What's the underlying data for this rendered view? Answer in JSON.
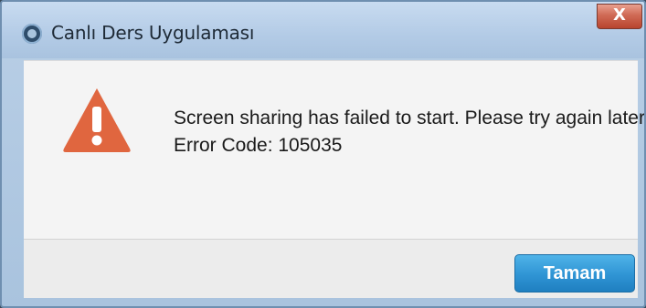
{
  "window": {
    "title": "Canlı Ders Uygulaması",
    "close_label": "X",
    "icon": "app-logo-icon"
  },
  "message": {
    "icon": "warning-icon",
    "line1": "Screen sharing has failed to start. Please try again later.",
    "line2": "Error Code: 105035"
  },
  "footer": {
    "ok_label": "Tamam"
  },
  "colors": {
    "warning": "#e0663f",
    "button": "#2f94d4"
  }
}
